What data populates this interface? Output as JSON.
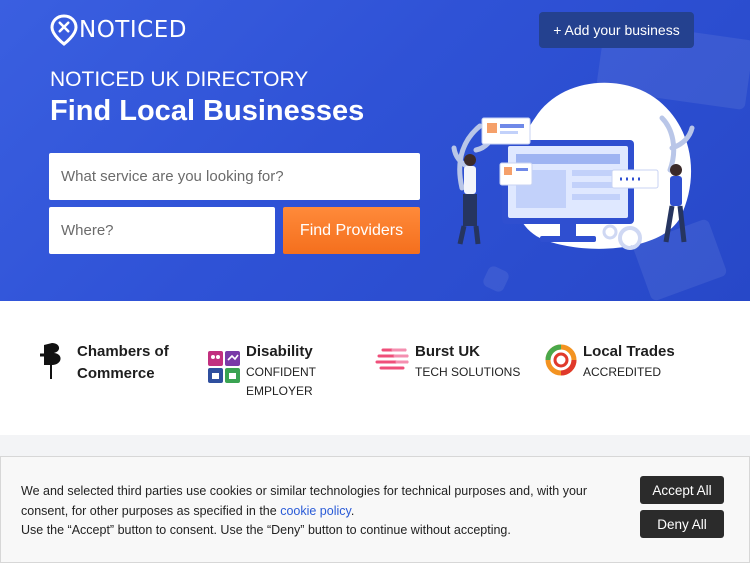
{
  "brand": {
    "name": "NOTICED"
  },
  "header": {
    "add_business_label": "+ Add your business"
  },
  "hero": {
    "eyebrow": "NOTICED UK DIRECTORY",
    "title": "Find Local Businesses",
    "service_placeholder": "What service are you looking for?",
    "where_placeholder": "Where?",
    "find_label": "Find Providers"
  },
  "trust_badges": [
    {
      "title_line1": "Chambers of",
      "title_line2": "Commerce",
      "icon": "chambers-of-commerce-icon"
    },
    {
      "title": "Disability",
      "sub_line1": "CONFIDENT",
      "sub_line2": "EMPLOYER",
      "icon": "disability-confident-icon"
    },
    {
      "title": "Burst UK",
      "sub": "TECH SOLUTIONS",
      "icon": "burst-uk-icon"
    },
    {
      "title": "Local Trades",
      "sub": "ACCREDITED",
      "icon": "local-trades-icon"
    }
  ],
  "cookie_banner": {
    "text_part1": "We and selected third parties use cookies or similar technologies for technical purposes and, with your consent, for other purposes as specified in the ",
    "link_text": "cookie policy",
    "text_part2": ".",
    "text_line3": "Use the “Accept” button to consent. Use the “Deny” button to continue without accepting.",
    "accept_label": "Accept All",
    "deny_label": "Deny All"
  },
  "colors": {
    "hero_blue": "#2f52d6",
    "button_dark_blue": "#24418f",
    "find_orange": "#f46f1d",
    "link_blue": "#2a5bd7"
  }
}
